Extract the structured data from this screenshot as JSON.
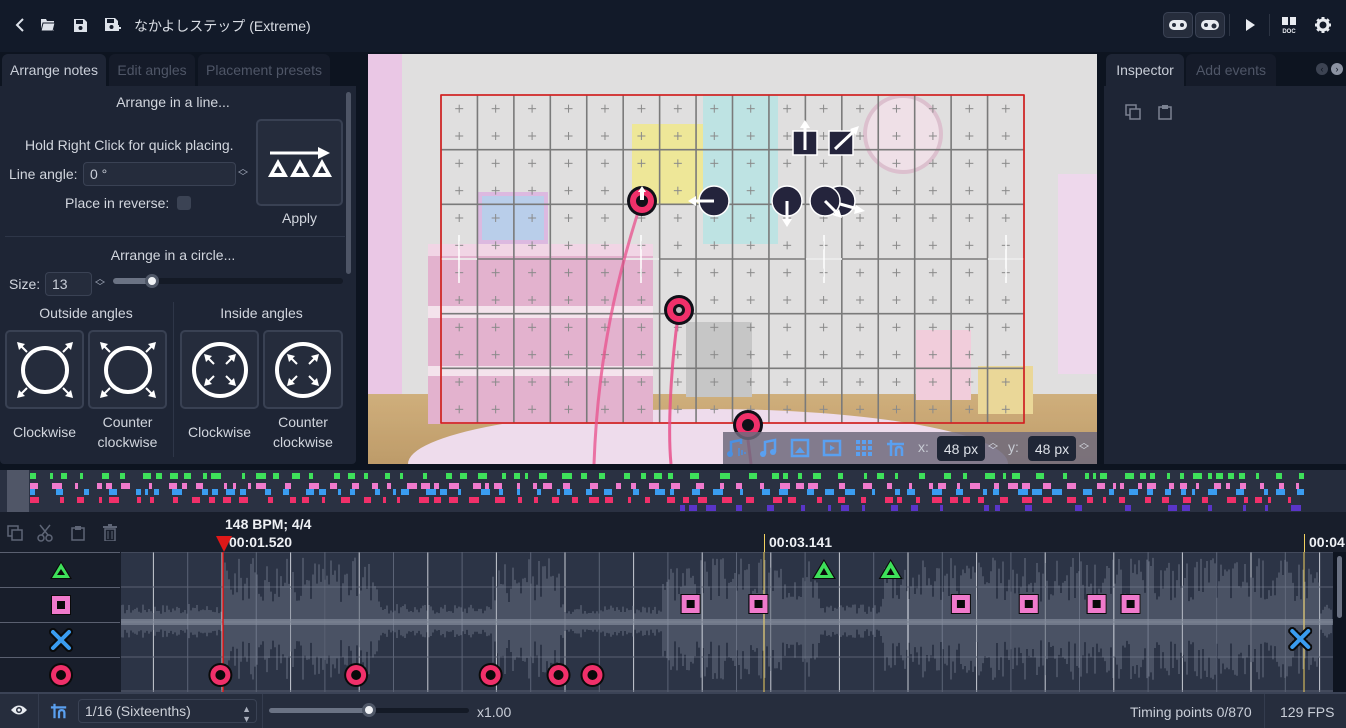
{
  "topbar": {
    "title": "なかよしステップ (Extreme)",
    "icons_left": [
      "back-chevron-icon",
      "open-folder-icon",
      "save-icon",
      "save-as-icon"
    ],
    "icons_right": [
      "gamepad-icon",
      "gamepad-test-icon",
      "play-icon",
      "doc-icon",
      "gear-icon"
    ]
  },
  "left_panel": {
    "tabs": [
      {
        "label": "Arrange notes",
        "active": true
      },
      {
        "label": "Edit angles",
        "active": false
      },
      {
        "label": "Placement presets",
        "active": false
      }
    ],
    "line_section": {
      "heading": "Arrange in a line...",
      "hint": "Hold Right Click for quick placing.",
      "line_angle_label": "Line angle:",
      "line_angle_value": "0 °",
      "reverse_label": "Place in reverse:",
      "reverse_checked": false,
      "apply_label": "Apply"
    },
    "circle_section": {
      "heading": "Arrange in a circle...",
      "size_label": "Size:",
      "size_value": "13",
      "size_slider_fraction": 0.17,
      "outside_heading": "Outside angles",
      "inside_heading": "Inside angles",
      "buttons": [
        {
          "label_line1": "Clockwise",
          "label_line2": ""
        },
        {
          "label_line1": "Counter",
          "label_line2": "clockwise"
        },
        {
          "label_line1": "Clockwise",
          "label_line2": ""
        },
        {
          "label_line1": "Counter",
          "label_line2": "clockwise"
        }
      ]
    }
  },
  "viewport": {
    "toolbar": {
      "icons": [
        "waveform-note-icon",
        "music-note-icon",
        "image-icon",
        "video-icon",
        "grid-icon",
        "snap-icon"
      ],
      "x_label": "x:",
      "x_value": "48 px",
      "y_label": "y:",
      "y_value": "48 px"
    }
  },
  "right_panel": {
    "tabs": [
      {
        "label": "Inspector",
        "active": true
      },
      {
        "label": "Add events",
        "active": false
      }
    ],
    "icons": [
      "copy-icon",
      "paste-icon"
    ]
  },
  "timeline": {
    "tool_icons": [
      "copy-icon",
      "cut-icon",
      "paste-icon",
      "delete-icon"
    ],
    "bpm_label": "148 BPM; 4/4",
    "cursor_time": "00:01.520",
    "markers": [
      "00:03.141",
      "00:04"
    ],
    "lanes": [
      "triangle",
      "square",
      "cross",
      "circle"
    ],
    "notes": {
      "triangle": [
        0.58,
        0.635
      ],
      "square": [
        0.47,
        0.526,
        0.693,
        0.749,
        0.805,
        0.833
      ],
      "cross": [
        0.973
      ],
      "circle": [
        0.082,
        0.194,
        0.305,
        0.361,
        0.389
      ]
    },
    "colors": {
      "triangle": "#3ee05a",
      "square": "#f07acc",
      "cross": "#3a9cf0",
      "circle": "#f0306a",
      "playhead": "#e01818",
      "marker": "#f0d060"
    }
  },
  "statusbar": {
    "division": "1/16 (Sixteenths)",
    "playback_speed": "x1.00",
    "speed_slider_fraction": 0.5,
    "timing_points": "Timing points 0/870",
    "fps": "129 FPS"
  }
}
